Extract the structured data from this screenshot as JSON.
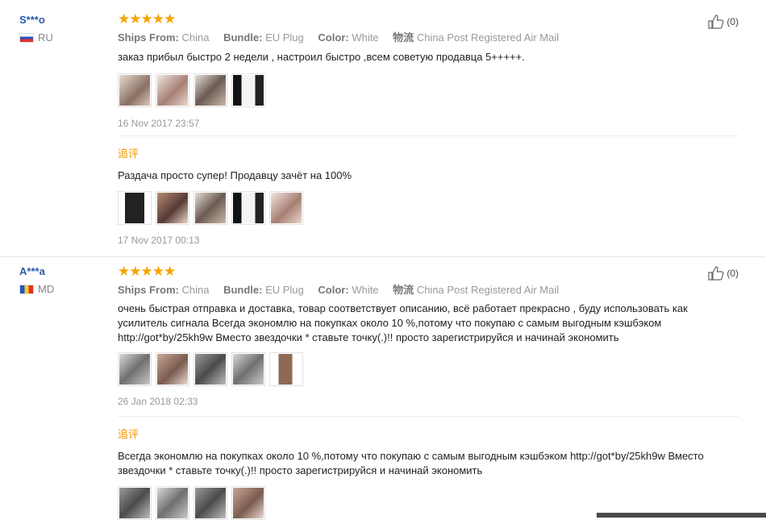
{
  "reviews": [
    {
      "user": "S***o",
      "country": "RU",
      "likes": "(0)",
      "stars": "★★★★★",
      "meta": {
        "ships_label": "Ships From:",
        "ships_value": "China",
        "bundle_label": "Bundle:",
        "bundle_value": "EU Plug",
        "color_label": "Color:",
        "color_value": "White",
        "logistics_label": "物流",
        "logistics_value": "China Post Registered Air Mail"
      },
      "text": "заказ прибыл быстро 2 недели , настроил быстро ,всем советую продавца 5+++++.",
      "date": "16 Nov 2017 23:57",
      "followup": {
        "label": "追评",
        "text": "Раздача просто супер! Продавцу зачёт на 100%",
        "date": "17 Nov 2017 00:13"
      }
    },
    {
      "user": "A***a",
      "country": "MD",
      "likes": "(0)",
      "stars": "★★★★★",
      "meta": {
        "ships_label": "Ships From:",
        "ships_value": "China",
        "bundle_label": "Bundle:",
        "bundle_value": "EU Plug",
        "color_label": "Color:",
        "color_value": "White",
        "logistics_label": "物流",
        "logistics_value": "China Post Registered Air Mail"
      },
      "text": "очень быстрая отправка и доставка, товар соответствует описанию, всё работает прекрасно , буду использовать как усилитель сигнала Всегда экономлю на покупках около 10 %,потому что покупаю с самым выгодным кэшбэком http://got*by/25kh9w Вместо звездочки * ставьте точку(.)!! просто зарегистрируйся и начинай экономить",
      "date": "26 Jan 2018 02:33",
      "followup": {
        "label": "追评",
        "text": "Всегда экономлю на покупках около 10 %,потому что покупаю с самым выгодным кэшбэком http://got*by/25kh9w Вместо звездочки * ставьте точку(.)!! просто зарегистрируйся и начинай экономить"
      }
    }
  ],
  "colors": {
    "accent": "#f39800",
    "username": "#2a5aa8",
    "stars": "#f7a300"
  },
  "icons": {
    "like": "thumbs-up-icon",
    "flag_ru": "flag-ru-icon",
    "flag_md": "flag-md-icon"
  }
}
